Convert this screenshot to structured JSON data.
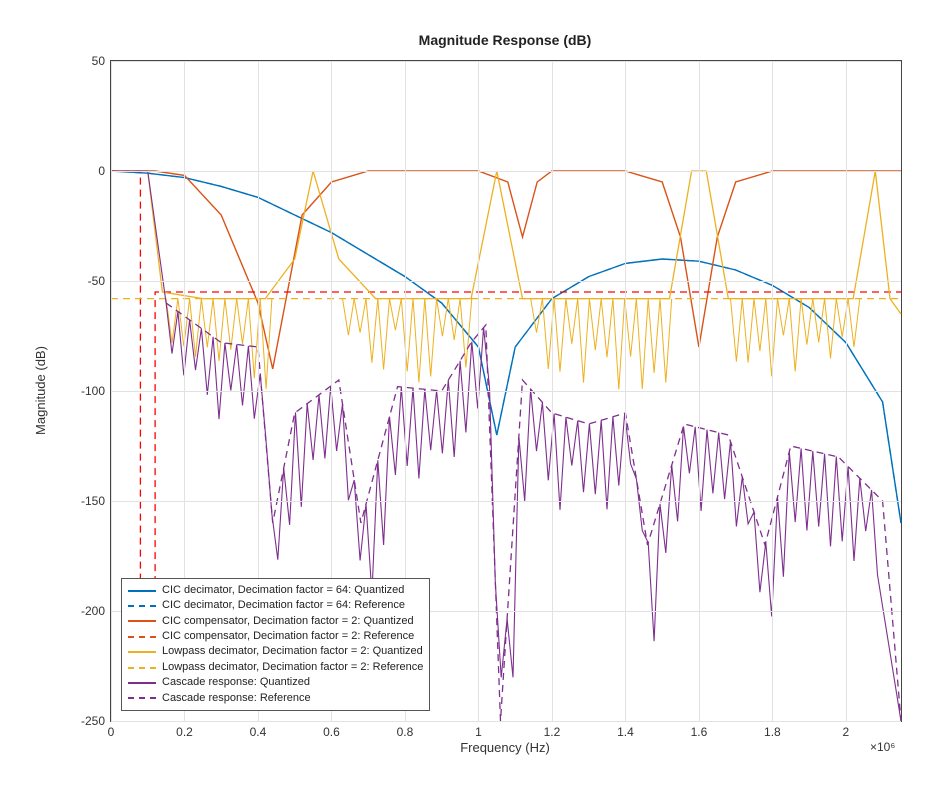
{
  "chart_data": {
    "type": "line",
    "title": "Magnitude Response (dB)",
    "xlabel": "Frequency (Hz)",
    "ylabel": "Magnitude (dB)",
    "xlim": [
      0,
      2150000.0
    ],
    "ylim": [
      -250,
      50
    ],
    "xticks": [
      0,
      200000.0,
      400000.0,
      600000.0,
      800000.0,
      1000000.0,
      1200000.0,
      1400000.0,
      1600000.0,
      1800000.0,
      2000000.0
    ],
    "xtick_labels": [
      "0",
      "0.2",
      "0.4",
      "0.6",
      "0.8",
      "1",
      "1.2",
      "1.4",
      "1.6",
      "1.8",
      "2"
    ],
    "yticks": [
      -250,
      -200,
      -150,
      -100,
      -50,
      0,
      50
    ],
    "ytick_labels": [
      "-250",
      "-200",
      "-150",
      "-100",
      "-50",
      "0",
      "50"
    ],
    "x_exponent_label": "×10⁶",
    "colors": {
      "s1": "#0072BD",
      "s2": "#D95319",
      "s3": "#EDB120",
      "s4": "#7E2F8E",
      "mask": "#FF0000"
    },
    "series": [
      {
        "name": "CIC decimator, Decimation factor = 64: Quantized",
        "style": "solid",
        "color": "#0072BD",
        "x": [
          0,
          100000.0,
          200000.0,
          300000.0,
          400000.0,
          500000.0,
          600000.0,
          700000.0,
          800000.0,
          900000.0,
          1000000.0,
          1050000.0,
          1100000.0,
          1200000.0,
          1300000.0,
          1400000.0,
          1500000.0,
          1600000.0,
          1700000.0,
          1800000.0,
          1900000.0,
          2000000.0,
          2100000.0,
          2150000.0
        ],
        "y": [
          0,
          -1,
          -3,
          -7,
          -12,
          -20,
          -28,
          -38,
          -48,
          -60,
          -80,
          -120,
          -80,
          -58,
          -48,
          -42,
          -40,
          -41,
          -45,
          -52,
          -62,
          -78,
          -105,
          -160
        ]
      },
      {
        "name": "CIC decimator, Decimation factor = 64: Reference",
        "style": "dashed",
        "color": "#0072BD",
        "x": [
          0,
          100000.0,
          200000.0,
          300000.0,
          400000.0,
          500000.0,
          600000.0,
          700000.0,
          800000.0,
          900000.0,
          1000000.0,
          1050000.0,
          1100000.0,
          1200000.0,
          1300000.0,
          1400000.0,
          1500000.0,
          1600000.0,
          1700000.0,
          1800000.0,
          1900000.0,
          2000000.0,
          2100000.0,
          2150000.0
        ],
        "y": [
          0,
          -1,
          -3,
          -7,
          -12,
          -20,
          -28,
          -38,
          -48,
          -60,
          -80,
          -120,
          -80,
          -58,
          -48,
          -42,
          -40,
          -41,
          -45,
          -52,
          -62,
          -78,
          -105,
          -160
        ]
      },
      {
        "name": "CIC compensator, Decimation factor = 2: Quantized",
        "style": "solid",
        "color": "#D95319",
        "x": [
          0,
          40000.0,
          80000.0,
          120000.0,
          200000.0,
          300000.0,
          400000.0,
          440000.0,
          480000.0,
          520000.0,
          600000.0,
          700000.0,
          800000.0,
          900000.0,
          1000000.0,
          1080000.0,
          1120000.0,
          1160000.0,
          1200000.0,
          1300000.0,
          1400000.0,
          1500000.0,
          1550000.0,
          1600000.0,
          1650000.0,
          1700000.0,
          1800000.0,
          1900000.0,
          2000000.0,
          2100000.0,
          2150000.0
        ],
        "y": [
          0,
          0,
          0,
          0,
          -2,
          -20,
          -60,
          -90,
          -55,
          -20,
          -5,
          0,
          0,
          0,
          0,
          -5,
          -30,
          -5,
          0,
          0,
          0,
          -5,
          -30,
          -80,
          -30,
          -5,
          0,
          0,
          0,
          0,
          0
        ]
      },
      {
        "name": "CIC compensator, Decimation factor = 2: Reference",
        "style": "dashed",
        "color": "#FF0000",
        "x": [
          0,
          80000.0,
          80000.0,
          120000.0,
          120000.0,
          2150000.0
        ],
        "y": [
          0,
          0,
          -190,
          -190,
          -55,
          -55
        ]
      },
      {
        "name": "Lowpass decimator, Decimation factor = 2: Quantized",
        "style": "solid",
        "color": "#EDB120",
        "scatter": true,
        "notches": {
          "start": 150000.0,
          "end": 2100000.0,
          "period": 32000.0,
          "baseline": -58,
          "depth_min": -70,
          "depth_max": -100,
          "gaps": [
            [
              420000.0,
              620000.0
            ],
            [
              980000.0,
              1120000.0
            ],
            [
              1520000.0,
              1680000.0
            ],
            [
              2020000.0,
              2150000.0
            ]
          ]
        },
        "envelope_x": [
          0,
          100000.0,
          140000.0,
          250000.0,
          420000.0,
          500000.0,
          550000.0,
          620000.0,
          720000.0,
          850000.0,
          980000.0,
          1050000.0,
          1120000.0,
          1300000.0,
          1520000.0,
          1580000.0,
          1620000.0,
          1680000.0,
          1850000.0,
          2020000.0,
          2080000.0,
          2120000.0,
          2150000.0
        ],
        "envelope_y": [
          0,
          0,
          -55,
          -58,
          -58,
          -40,
          0,
          -40,
          -58,
          -58,
          -58,
          0,
          -58,
          -58,
          -58,
          0,
          0,
          -58,
          -58,
          -58,
          0,
          -58,
          -65
        ]
      },
      {
        "name": "Lowpass decimator, Decimation factor = 2: Reference",
        "style": "dashed",
        "color": "#EDB120",
        "x": [
          0,
          2150000.0
        ],
        "y": [
          -58,
          -58
        ]
      },
      {
        "name": "Cascade response: Quantized",
        "style": "solid",
        "color": "#7E2F8E",
        "scatter": true,
        "notches": {
          "start": 150000.0,
          "end": 2100000.0,
          "period": 32000.0,
          "baseline_curve": [
            [
              150000.0,
              -60
            ],
            [
              300000.0,
              -78
            ],
            [
              400000.0,
              -80
            ],
            [
              440000.0,
              -160
            ],
            [
              500000.0,
              -110
            ],
            [
              620000.0,
              -95
            ],
            [
              680000.0,
              -160
            ],
            [
              780000.0,
              -98
            ],
            [
              900000.0,
              -100
            ],
            [
              980000.0,
              -78
            ],
            [
              1020000.0,
              -70
            ],
            [
              1060000.0,
              -250
            ],
            [
              1120000.0,
              -95
            ],
            [
              1200000.0,
              -110
            ],
            [
              1300000.0,
              -115
            ],
            [
              1400000.0,
              -110
            ],
            [
              1460000.0,
              -170
            ],
            [
              1560000.0,
              -115
            ],
            [
              1680000.0,
              -120
            ],
            [
              1780000.0,
              -170
            ],
            [
              1850000.0,
              -125
            ],
            [
              1980000.0,
              -130
            ],
            [
              2100000.0,
              -150
            ],
            [
              2150000.0,
              -250
            ]
          ],
          "depth": 30
        }
      },
      {
        "name": "Cascade response: Reference",
        "style": "dashed",
        "color": "#7E2F8E",
        "x": [
          150000.0,
          300000.0,
          400000.0,
          440000.0,
          500000.0,
          620000.0,
          680000.0,
          780000.0,
          900000.0,
          980000.0,
          1020000.0,
          1060000.0,
          1120000.0,
          1200000.0,
          1300000.0,
          1400000.0,
          1460000.0,
          1560000.0,
          1680000.0,
          1780000.0,
          1850000.0,
          1980000.0,
          2100000.0,
          2150000.0
        ],
        "y": [
          -60,
          -78,
          -80,
          -160,
          -110,
          -95,
          -160,
          -98,
          -100,
          -78,
          -70,
          -250,
          -95,
          -110,
          -115,
          -110,
          -170,
          -115,
          -120,
          -170,
          -125,
          -130,
          -150,
          -250
        ]
      }
    ],
    "legend": {
      "position": "lower-left",
      "items": [
        {
          "label": "CIC decimator, Decimation factor = 64: Quantized",
          "color": "#0072BD",
          "style": "solid"
        },
        {
          "label": "CIC decimator, Decimation factor = 64: Reference",
          "color": "#0072BD",
          "style": "dashed"
        },
        {
          "label": "CIC compensator, Decimation factor = 2: Quantized",
          "color": "#D95319",
          "style": "solid"
        },
        {
          "label": "CIC compensator, Decimation factor = 2: Reference",
          "color": "#D95319",
          "style": "dashed"
        },
        {
          "label": "Lowpass decimator, Decimation factor = 2: Quantized",
          "color": "#EDB120",
          "style": "solid"
        },
        {
          "label": "Lowpass decimator, Decimation factor = 2: Reference",
          "color": "#EDB120",
          "style": "dashed"
        },
        {
          "label": "Cascade response: Quantized",
          "color": "#7E2F8E",
          "style": "solid"
        },
        {
          "label": "Cascade response: Reference",
          "color": "#7E2F8E",
          "style": "dashed"
        }
      ]
    }
  }
}
